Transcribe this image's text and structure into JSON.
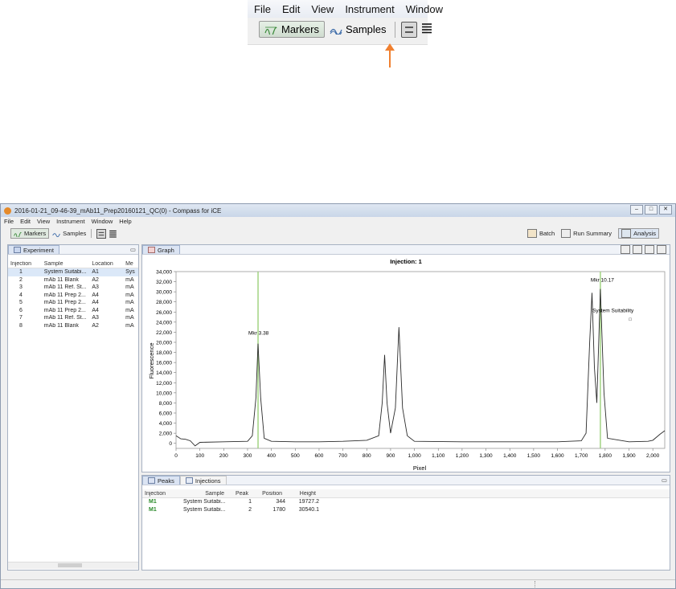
{
  "zoom": {
    "menu": [
      "File",
      "Edit",
      "View",
      "Instrument",
      "Window"
    ],
    "markers_label": "Markers",
    "samples_label": "Samples"
  },
  "window": {
    "title": "2016-01-21_09-46-39_mAb11_Prep20160121_QC(0) - Compass for iCE",
    "menu": [
      "File",
      "Edit",
      "View",
      "Instrument",
      "Window",
      "Help"
    ],
    "toolbar": {
      "markers_label": "Markers",
      "samples_label": "Samples",
      "batch_label": "Batch",
      "run_summary_label": "Run Summary",
      "analysis_label": "Analysis"
    }
  },
  "experiment": {
    "tab_label": "Experiment",
    "columns": [
      "Injection",
      "Sample",
      "Location",
      "Me"
    ],
    "rows": [
      [
        "1",
        "System Suitabi...",
        "A1",
        "Sys"
      ],
      [
        "2",
        "mAb 11 Blank",
        "A2",
        "mA"
      ],
      [
        "3",
        "mAb 11 Ref. St...",
        "A3",
        "mA"
      ],
      [
        "4",
        "mAb 11 Prep 2...",
        "A4",
        "mA"
      ],
      [
        "5",
        "mAb 11 Prep 2...",
        "A4",
        "mA"
      ],
      [
        "6",
        "mAb 11 Prep 2...",
        "A4",
        "mA"
      ],
      [
        "7",
        "mAb 11 Ref. St...",
        "A3",
        "mA"
      ],
      [
        "8",
        "mAb 11 Blank",
        "A2",
        "mA"
      ]
    ]
  },
  "graph": {
    "tab_label": "Graph",
    "title": "Injection: 1",
    "xlabel": "Pixel",
    "ylabel": "Fluorescence",
    "marker1_label": "Mkr 3.38",
    "marker2_label": "Mkr 10.17",
    "annotation": "System Suitability",
    "x_ticks": [
      "0",
      "100",
      "200",
      "300",
      "400",
      "500",
      "600",
      "700",
      "800",
      "900",
      "1,000",
      "1,100",
      "1,200",
      "1,300",
      "1,400",
      "1,500",
      "1,600",
      "1,700",
      "1,800",
      "1,900",
      "2,000"
    ],
    "y_ticks": [
      "0",
      "2,000",
      "4,000",
      "6,000",
      "8,000",
      "10,000",
      "12,000",
      "14,000",
      "16,000",
      "18,000",
      "20,000",
      "22,000",
      "24,000",
      "26,000",
      "28,000",
      "30,000",
      "32,000",
      "34,000"
    ],
    "colors": {
      "trace": "#2b2b2b",
      "marker": "#9bd07a"
    }
  },
  "chart_data": {
    "type": "line",
    "title": "Injection: 1",
    "xlabel": "Pixel",
    "ylabel": "Fluorescence",
    "xlim": [
      0,
      2050
    ],
    "ylim": [
      -1000,
      34000
    ],
    "grid": false,
    "series": [
      {
        "x": [
          0,
          20,
          40,
          60,
          80,
          100,
          200,
          300,
          320,
          335,
          344,
          355,
          370,
          400,
          500,
          600,
          700,
          800,
          850,
          865,
          875,
          885,
          900,
          920,
          935,
          950,
          970,
          1000,
          1200,
          1400,
          1500,
          1600,
          1700,
          1720,
          1735,
          1745,
          1755,
          1765,
          1780,
          1795,
          1810,
          1900,
          1980,
          2000,
          2030,
          2050
        ],
        "y": [
          1500,
          900,
          800,
          500,
          -500,
          200,
          300,
          400,
          1500,
          9000,
          19727,
          9000,
          1000,
          400,
          300,
          300,
          400,
          600,
          1500,
          8000,
          17500,
          8000,
          2000,
          7000,
          23000,
          7000,
          1500,
          400,
          300,
          300,
          300,
          300,
          500,
          2000,
          20000,
          29800,
          15000,
          8000,
          30540,
          10000,
          1000,
          300,
          400,
          600,
          1800,
          2500
        ]
      }
    ],
    "markers": [
      {
        "label": "Mkr 3.38",
        "x": 344
      },
      {
        "label": "Mkr 10.17",
        "x": 1780
      }
    ]
  },
  "peaks": {
    "tab_label": "Peaks",
    "tab2_label": "Injections",
    "columns": [
      "Injection",
      "Sample",
      "Peak",
      "Position",
      "Height"
    ],
    "rows": [
      [
        "M1",
        "System Suitabi...",
        "1",
        "344",
        "19727.2"
      ],
      [
        "M1",
        "System Suitabi...",
        "2",
        "1780",
        "30540.1"
      ]
    ]
  }
}
